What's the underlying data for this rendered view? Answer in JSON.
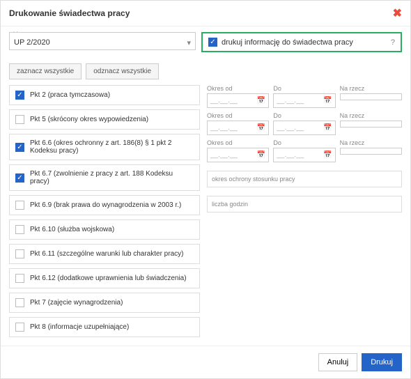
{
  "title": "Drukowanie świadectwa pracy",
  "umowa": {
    "label": "Umowa",
    "value": "UP 2/2020"
  },
  "printinfo": {
    "label": "drukuj informację do świadectwa pracy",
    "help": "?"
  },
  "selectall": "zaznacz wszystkie",
  "deselectall": "odznacz wszystkie",
  "items": [
    {
      "checked": true,
      "label": "Pkt 2 (praca tymczasowa)"
    },
    {
      "checked": false,
      "label": "Pkt 5 (skrócony okres wypowiedzenia)"
    },
    {
      "checked": true,
      "label": "Pkt 6.6 (okres ochronny z art. 186(8) § 1 pkt 2 Kodeksu pracy)"
    },
    {
      "checked": true,
      "label": "Pkt 6.7 (zwolnienie z pracy z art. 188 Kodeksu pracy)"
    },
    {
      "checked": false,
      "label": "Pkt 6.9 (brak prawa do wynagrodzenia w 2003 r.)"
    },
    {
      "checked": false,
      "label": "Pkt 6.10 (służba wojskowa)"
    },
    {
      "checked": false,
      "label": "Pkt 6.11 (szczególne warunki lub charakter pracy)"
    },
    {
      "checked": false,
      "label": "Pkt 6.12 (dodatkowe uprawnienia lub świadczenia)"
    },
    {
      "checked": false,
      "label": "Pkt 7 (zajęcie wynagrodzenia)"
    },
    {
      "checked": false,
      "label": "Pkt 8 (informacje uzupełniające)"
    }
  ],
  "cols": {
    "od": "Okres od",
    "do": "Do",
    "na": "Na rzecz"
  },
  "dateplaceholder": "__.__.__",
  "tfields": [
    "okres ochrony stosunku pracy",
    "liczba godzin"
  ],
  "footer": {
    "cancel": "Anuluj",
    "print": "Drukuj"
  }
}
